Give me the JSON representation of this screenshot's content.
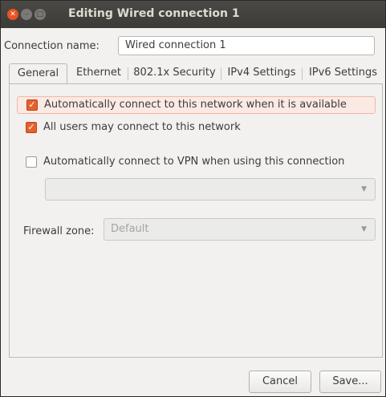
{
  "window": {
    "title": "Editing Wired connection 1"
  },
  "connection_name": {
    "label": "Connection name:",
    "value": "Wired connection 1"
  },
  "tabs": [
    {
      "label": "General",
      "active": true
    },
    {
      "label": "Ethernet",
      "active": false
    },
    {
      "label": "802.1x Security",
      "active": false
    },
    {
      "label": "IPv4 Settings",
      "active": false
    },
    {
      "label": "IPv6 Settings",
      "active": false
    }
  ],
  "general": {
    "auto_connect": {
      "label": "Automatically connect to this network when it is available",
      "checked": true
    },
    "all_users": {
      "label": "All users may connect to this network",
      "checked": true
    },
    "auto_vpn": {
      "label": "Automatically connect to VPN when using this connection",
      "checked": false
    },
    "vpn_select": {
      "value": ""
    },
    "firewall_zone": {
      "label": "Firewall zone:",
      "value": "Default"
    }
  },
  "buttons": {
    "cancel": "Cancel",
    "save": "Save..."
  },
  "colors": {
    "accent": "#e2622f",
    "titlebar": "#3c3b37",
    "highlight": "#fbe9e3"
  }
}
